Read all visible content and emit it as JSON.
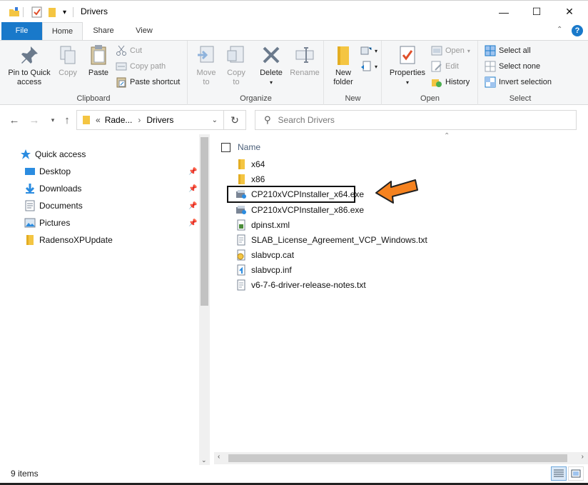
{
  "window": {
    "title": "Drivers",
    "minimize_glyph": "—",
    "maximize_glyph": "☐",
    "close_glyph": "✕"
  },
  "tabs": [
    {
      "label": "File"
    },
    {
      "label": "Home"
    },
    {
      "label": "Share"
    },
    {
      "label": "View"
    }
  ],
  "ribbon": {
    "clipboard": {
      "label": "Clipboard",
      "pin_line1": "Pin to Quick",
      "pin_line2": "access",
      "copy": "Copy",
      "paste": "Paste",
      "cut": "Cut",
      "copy_path": "Copy path",
      "paste_shortcut": "Paste shortcut"
    },
    "organize": {
      "label": "Organize",
      "move_to": "Move",
      "move_to2": "to",
      "copy_to": "Copy",
      "copy_to2": "to",
      "delete": "Delete",
      "rename": "Rename"
    },
    "new": {
      "label": "New",
      "new_folder1": "New",
      "new_folder2": "folder"
    },
    "open": {
      "label": "Open",
      "properties": "Properties",
      "open": "Open",
      "edit": "Edit",
      "history": "History"
    },
    "select": {
      "label": "Select",
      "select_all": "Select all",
      "select_none": "Select none",
      "invert_selection": "Invert selection"
    }
  },
  "address": {
    "overflow": "«",
    "crumb1": "Rade...",
    "separator": "›",
    "crumb2": "Drivers",
    "search_placeholder": "Search Drivers"
  },
  "navpane": {
    "quick_access": "Quick access",
    "items": [
      {
        "label": "Desktop",
        "pinned": true
      },
      {
        "label": "Downloads",
        "pinned": true
      },
      {
        "label": "Documents",
        "pinned": true
      },
      {
        "label": "Pictures",
        "pinned": true
      },
      {
        "label": "RadensoXPUpdate",
        "pinned": false
      }
    ]
  },
  "filelist": {
    "column_name": "Name",
    "files": [
      {
        "name": "x64",
        "icon": "folder-icon"
      },
      {
        "name": "x86",
        "icon": "folder-icon"
      },
      {
        "name": "CP210xVCPInstaller_x64.exe",
        "icon": "installer-icon",
        "highlighted": true
      },
      {
        "name": "CP210xVCPInstaller_x86.exe",
        "icon": "installer-icon"
      },
      {
        "name": "dpinst.xml",
        "icon": "xml-file-icon"
      },
      {
        "name": "SLAB_License_Agreement_VCP_Windows.txt",
        "icon": "text-file-icon"
      },
      {
        "name": "slabvcp.cat",
        "icon": "catalog-file-icon"
      },
      {
        "name": "slabvcp.inf",
        "icon": "setup-info-file-icon"
      },
      {
        "name": "v6-7-6-driver-release-notes.txt",
        "icon": "text-file-icon"
      }
    ]
  },
  "status": {
    "item_count": "9 items"
  },
  "colors": {
    "accent": "#1979ca",
    "folder": "#f4c542",
    "arrow": "#f5821f"
  }
}
